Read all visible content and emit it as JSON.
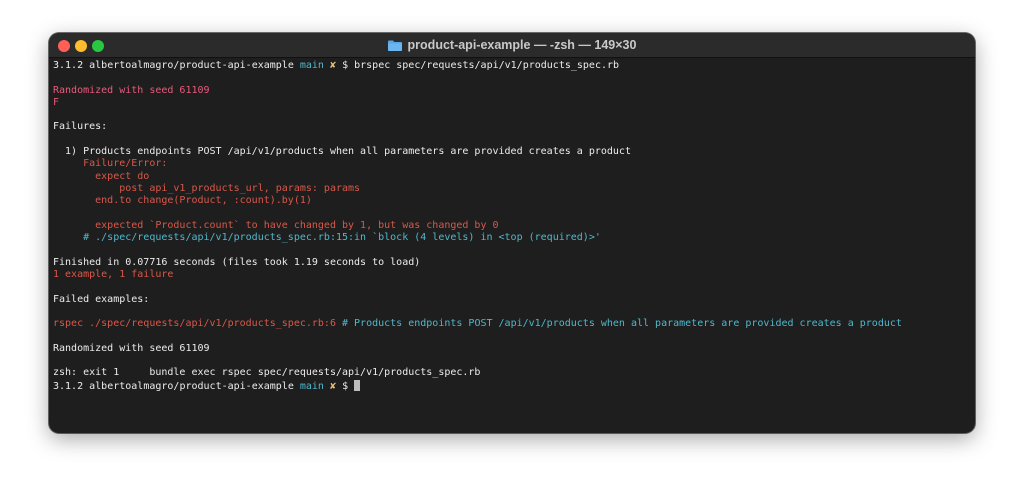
{
  "window": {
    "title": "product-api-example — -zsh — 149×30",
    "folder_icon": "folder-icon",
    "colors": {
      "close": "#ff5f57",
      "minimize": "#febc2e",
      "zoom": "#28c840",
      "background": "#1e1e1e"
    }
  },
  "terminal": {
    "prompt1": {
      "version": "3.1.2",
      "path": "albertoalmagro/product-api-example",
      "branch": "main",
      "dirty_mark": "✘",
      "dollar": "$",
      "command": "brspec spec/requests/api/v1/products_spec.rb"
    },
    "seed_line": "Randomized with seed 61109",
    "progress": "F",
    "failures_header": "Failures:",
    "failure_title": "  1) Products endpoints POST /api/v1/products when all parameters are provided creates a product",
    "failure_error": "     Failure/Error:",
    "code1": "       expect do",
    "code2": "           post api_v1_products_url, params: params",
    "code3": "       end.to change(Product, :count).by(1)",
    "expected_msg": "       expected `Product.count` to have changed by 1, but was changed by 0",
    "backtrace": "     # ./spec/requests/api/v1/products_spec.rb:15:in `block (4 levels) in <top (required)>'",
    "finished": "Finished in 0.07716 seconds (files took 1.19 seconds to load)",
    "summary": "1 example, 1 failure",
    "failed_examples_header": "Failed examples:",
    "rerun_cmd": "rspec ./spec/requests/api/v1/products_spec.rb:6",
    "rerun_comment": " # Products endpoints POST /api/v1/products when all parameters are provided creates a product",
    "seed_line2": "Randomized with seed 61109",
    "exit_line": "zsh: exit 1     bundle exec rspec spec/requests/api/v1/products_spec.rb",
    "prompt2": {
      "version": "3.1.2",
      "path": "albertoalmagro/product-api-example",
      "branch": "main",
      "dirty_mark": "✘",
      "dollar": "$"
    }
  }
}
